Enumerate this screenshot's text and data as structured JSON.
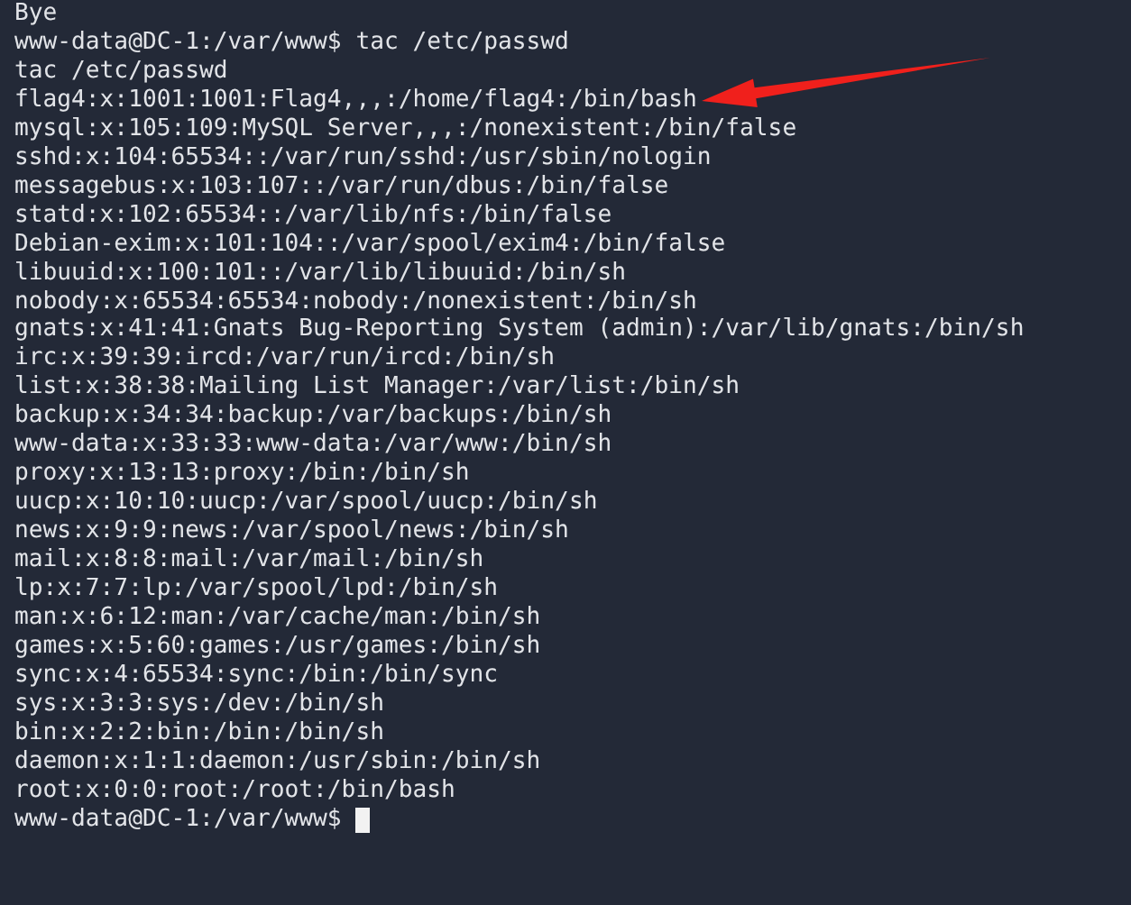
{
  "terminal": {
    "lines": [
      {
        "kind": "output",
        "text": "Bye",
        "marked": false
      },
      {
        "kind": "prompt",
        "prompt": "www-data@DC-1:/var/www$",
        "command": "tac /etc/passwd",
        "cursor": false,
        "marked": false
      },
      {
        "kind": "output",
        "text": "tac /etc/passwd",
        "marked": false
      },
      {
        "kind": "output",
        "text": "flag4:x:1001:1001:Flag4,,,:/home/flag4:/bin/bash",
        "marked": true
      },
      {
        "kind": "output",
        "text": "mysql:x:105:109:MySQL Server,,,:/nonexistent:/bin/false",
        "marked": false
      },
      {
        "kind": "output",
        "text": "sshd:x:104:65534::/var/run/sshd:/usr/sbin/nologin",
        "marked": false
      },
      {
        "kind": "output",
        "text": "messagebus:x:103:107::/var/run/dbus:/bin/false",
        "marked": false
      },
      {
        "kind": "output",
        "text": "statd:x:102:65534::/var/lib/nfs:/bin/false",
        "marked": false
      },
      {
        "kind": "output",
        "text": "Debian-exim:x:101:104::/var/spool/exim4:/bin/false",
        "marked": false
      },
      {
        "kind": "output",
        "text": "libuuid:x:100:101::/var/lib/libuuid:/bin/sh",
        "marked": false
      },
      {
        "kind": "output",
        "text": "nobody:x:65534:65534:nobody:/nonexistent:/bin/sh",
        "marked": false
      },
      {
        "kind": "output",
        "text": "gnats:x:41:41:Gnats Bug-Reporting System (admin):/var/lib/gnats:/bin/sh",
        "marked": false
      },
      {
        "kind": "output",
        "text": "irc:x:39:39:ircd:/var/run/ircd:/bin/sh",
        "marked": false
      },
      {
        "kind": "output",
        "text": "list:x:38:38:Mailing List Manager:/var/list:/bin/sh",
        "marked": false
      },
      {
        "kind": "output",
        "text": "backup:x:34:34:backup:/var/backups:/bin/sh",
        "marked": false
      },
      {
        "kind": "output",
        "text": "www-data:x:33:33:www-data:/var/www:/bin/sh",
        "marked": false
      },
      {
        "kind": "output",
        "text": "proxy:x:13:13:proxy:/bin:/bin/sh",
        "marked": false
      },
      {
        "kind": "output",
        "text": "uucp:x:10:10:uucp:/var/spool/uucp:/bin/sh",
        "marked": false
      },
      {
        "kind": "output",
        "text": "news:x:9:9:news:/var/spool/news:/bin/sh",
        "marked": false
      },
      {
        "kind": "output",
        "text": "mail:x:8:8:mail:/var/mail:/bin/sh",
        "marked": false
      },
      {
        "kind": "output",
        "text": "lp:x:7:7:lp:/var/spool/lpd:/bin/sh",
        "marked": false
      },
      {
        "kind": "output",
        "text": "man:x:6:12:man:/var/cache/man:/bin/sh",
        "marked": false
      },
      {
        "kind": "output",
        "text": "games:x:5:60:games:/usr/games:/bin/sh",
        "marked": false
      },
      {
        "kind": "output",
        "text": "sync:x:4:65534:sync:/bin:/bin/sync",
        "marked": false
      },
      {
        "kind": "output",
        "text": "sys:x:3:3:sys:/dev:/bin/sh",
        "marked": false
      },
      {
        "kind": "output",
        "text": "bin:x:2:2:bin:/bin:/bin/sh",
        "marked": false
      },
      {
        "kind": "output",
        "text": "daemon:x:1:1:daemon:/usr/sbin:/bin/sh",
        "marked": false
      },
      {
        "kind": "output",
        "text": "root:x:0:0:root:/root:/bin/bash",
        "marked": false
      },
      {
        "kind": "prompt",
        "prompt": "www-data@DC-1:/var/www$",
        "cursor": true,
        "marked": false
      }
    ]
  }
}
